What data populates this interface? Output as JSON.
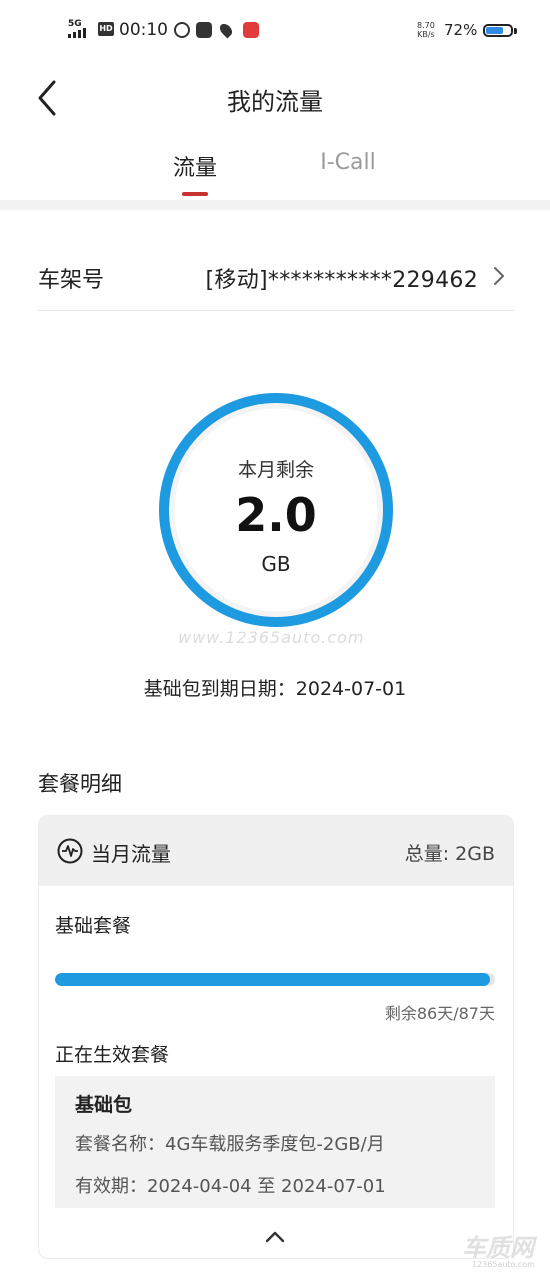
{
  "status_bar": {
    "network": "5G",
    "hd": "HD",
    "time": "00:10",
    "speed_value": "8.70",
    "speed_unit": "KB/s",
    "battery_pct": "72%",
    "battery_level": 0.72,
    "icons": [
      "browser-icon",
      "taobao-icon",
      "location-icon",
      "app-icon"
    ]
  },
  "header": {
    "title": "我的流量",
    "tabs": [
      {
        "label": "流量",
        "active": true
      },
      {
        "label": "I-Call",
        "active": false
      }
    ]
  },
  "vin": {
    "label": "车架号",
    "value": "[移动]***********229462"
  },
  "gauge": {
    "label": "本月剩余",
    "value": "2.0",
    "unit": "GB",
    "ring_color": "#1e9ae0"
  },
  "watermark": "www.12365auto.com",
  "expiry": "基础包到期日期：2024-07-01",
  "details": {
    "section_title": "套餐明细",
    "card_title": "当月流量",
    "total": "总量: 2GB",
    "base_plan_label": "基础套餐",
    "progress": 0.9885,
    "remaining_days": "剩余86天/87天",
    "active_label": "正在生效套餐",
    "package": {
      "title": "基础包",
      "name": "套餐名称：4G车载服务季度包-2GB/月",
      "validity": "有效期：2024-04-04 至 2024-07-01"
    }
  },
  "brand": {
    "logo_text": "车质网",
    "logo_url": "12365auto.com"
  },
  "colors": {
    "accent_red": "#c7312e",
    "progress_blue": "#1e9ae0"
  }
}
